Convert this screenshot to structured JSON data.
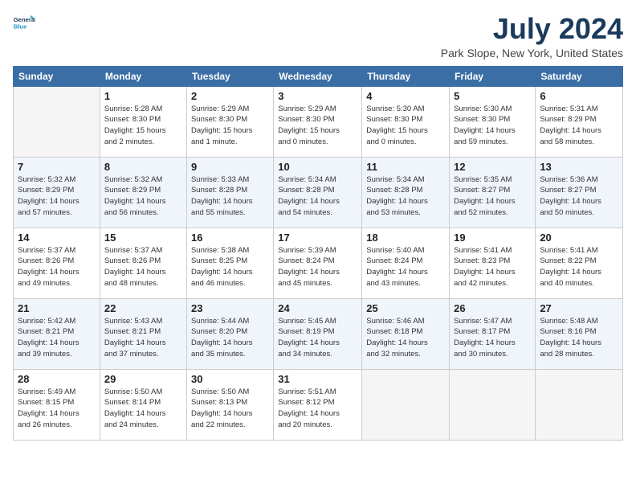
{
  "logo": {
    "line1": "General",
    "line2": "Blue"
  },
  "title": "July 2024",
  "location": "Park Slope, New York, United States",
  "headers": [
    "Sunday",
    "Monday",
    "Tuesday",
    "Wednesday",
    "Thursday",
    "Friday",
    "Saturday"
  ],
  "weeks": [
    [
      {
        "day": "",
        "info": ""
      },
      {
        "day": "1",
        "info": "Sunrise: 5:28 AM\nSunset: 8:30 PM\nDaylight: 15 hours\nand 2 minutes."
      },
      {
        "day": "2",
        "info": "Sunrise: 5:29 AM\nSunset: 8:30 PM\nDaylight: 15 hours\nand 1 minute."
      },
      {
        "day": "3",
        "info": "Sunrise: 5:29 AM\nSunset: 8:30 PM\nDaylight: 15 hours\nand 0 minutes."
      },
      {
        "day": "4",
        "info": "Sunrise: 5:30 AM\nSunset: 8:30 PM\nDaylight: 15 hours\nand 0 minutes."
      },
      {
        "day": "5",
        "info": "Sunrise: 5:30 AM\nSunset: 8:30 PM\nDaylight: 14 hours\nand 59 minutes."
      },
      {
        "day": "6",
        "info": "Sunrise: 5:31 AM\nSunset: 8:29 PM\nDaylight: 14 hours\nand 58 minutes."
      }
    ],
    [
      {
        "day": "7",
        "info": "Sunrise: 5:32 AM\nSunset: 8:29 PM\nDaylight: 14 hours\nand 57 minutes."
      },
      {
        "day": "8",
        "info": "Sunrise: 5:32 AM\nSunset: 8:29 PM\nDaylight: 14 hours\nand 56 minutes."
      },
      {
        "day": "9",
        "info": "Sunrise: 5:33 AM\nSunset: 8:28 PM\nDaylight: 14 hours\nand 55 minutes."
      },
      {
        "day": "10",
        "info": "Sunrise: 5:34 AM\nSunset: 8:28 PM\nDaylight: 14 hours\nand 54 minutes."
      },
      {
        "day": "11",
        "info": "Sunrise: 5:34 AM\nSunset: 8:28 PM\nDaylight: 14 hours\nand 53 minutes."
      },
      {
        "day": "12",
        "info": "Sunrise: 5:35 AM\nSunset: 8:27 PM\nDaylight: 14 hours\nand 52 minutes."
      },
      {
        "day": "13",
        "info": "Sunrise: 5:36 AM\nSunset: 8:27 PM\nDaylight: 14 hours\nand 50 minutes."
      }
    ],
    [
      {
        "day": "14",
        "info": "Sunrise: 5:37 AM\nSunset: 8:26 PM\nDaylight: 14 hours\nand 49 minutes."
      },
      {
        "day": "15",
        "info": "Sunrise: 5:37 AM\nSunset: 8:26 PM\nDaylight: 14 hours\nand 48 minutes."
      },
      {
        "day": "16",
        "info": "Sunrise: 5:38 AM\nSunset: 8:25 PM\nDaylight: 14 hours\nand 46 minutes."
      },
      {
        "day": "17",
        "info": "Sunrise: 5:39 AM\nSunset: 8:24 PM\nDaylight: 14 hours\nand 45 minutes."
      },
      {
        "day": "18",
        "info": "Sunrise: 5:40 AM\nSunset: 8:24 PM\nDaylight: 14 hours\nand 43 minutes."
      },
      {
        "day": "19",
        "info": "Sunrise: 5:41 AM\nSunset: 8:23 PM\nDaylight: 14 hours\nand 42 minutes."
      },
      {
        "day": "20",
        "info": "Sunrise: 5:41 AM\nSunset: 8:22 PM\nDaylight: 14 hours\nand 40 minutes."
      }
    ],
    [
      {
        "day": "21",
        "info": "Sunrise: 5:42 AM\nSunset: 8:21 PM\nDaylight: 14 hours\nand 39 minutes."
      },
      {
        "day": "22",
        "info": "Sunrise: 5:43 AM\nSunset: 8:21 PM\nDaylight: 14 hours\nand 37 minutes."
      },
      {
        "day": "23",
        "info": "Sunrise: 5:44 AM\nSunset: 8:20 PM\nDaylight: 14 hours\nand 35 minutes."
      },
      {
        "day": "24",
        "info": "Sunrise: 5:45 AM\nSunset: 8:19 PM\nDaylight: 14 hours\nand 34 minutes."
      },
      {
        "day": "25",
        "info": "Sunrise: 5:46 AM\nSunset: 8:18 PM\nDaylight: 14 hours\nand 32 minutes."
      },
      {
        "day": "26",
        "info": "Sunrise: 5:47 AM\nSunset: 8:17 PM\nDaylight: 14 hours\nand 30 minutes."
      },
      {
        "day": "27",
        "info": "Sunrise: 5:48 AM\nSunset: 8:16 PM\nDaylight: 14 hours\nand 28 minutes."
      }
    ],
    [
      {
        "day": "28",
        "info": "Sunrise: 5:49 AM\nSunset: 8:15 PM\nDaylight: 14 hours\nand 26 minutes."
      },
      {
        "day": "29",
        "info": "Sunrise: 5:50 AM\nSunset: 8:14 PM\nDaylight: 14 hours\nand 24 minutes."
      },
      {
        "day": "30",
        "info": "Sunrise: 5:50 AM\nSunset: 8:13 PM\nDaylight: 14 hours\nand 22 minutes."
      },
      {
        "day": "31",
        "info": "Sunrise: 5:51 AM\nSunset: 8:12 PM\nDaylight: 14 hours\nand 20 minutes."
      },
      {
        "day": "",
        "info": ""
      },
      {
        "day": "",
        "info": ""
      },
      {
        "day": "",
        "info": ""
      }
    ]
  ]
}
